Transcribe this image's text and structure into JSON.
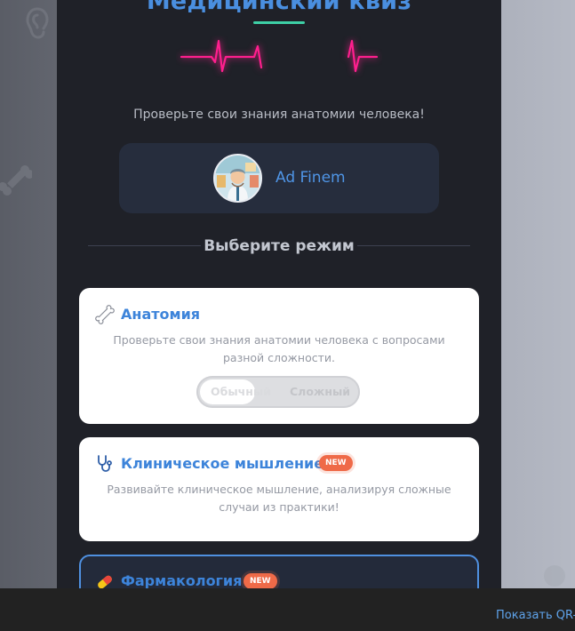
{
  "header": {
    "title": "Медицинский квиз",
    "subtitle": "Проверьте свои знания анатомии человека!"
  },
  "author": {
    "name": "Ad Finem",
    "avatar_icon": "doctor-avatar"
  },
  "mode_section": {
    "label": "Выберите режим"
  },
  "modes": [
    {
      "icon": "bone-icon",
      "title": "Анатомия",
      "description": "Проверьте свои знания анатомии человека с вопросами разной сложности.",
      "difficulty": {
        "options": [
          "Обычный",
          "Сложный"
        ],
        "selected": "Обычный"
      }
    },
    {
      "icon": "stethoscope-icon",
      "title": "Клиническое мышление",
      "badge": "NEW",
      "description": "Развивайте клиническое мышление, анализируя сложные случаи из практики!"
    },
    {
      "icon": "pill-icon",
      "title": "Фармакология",
      "badge": "NEW"
    }
  ],
  "footer": {
    "qr_link": "Показать QR-к"
  },
  "colors": {
    "accent": "#4a8fe0",
    "ecg": "#ff1f8e",
    "underline": "#3ed0a6",
    "badge": "#ef6a48",
    "panel": "#1f2128"
  }
}
